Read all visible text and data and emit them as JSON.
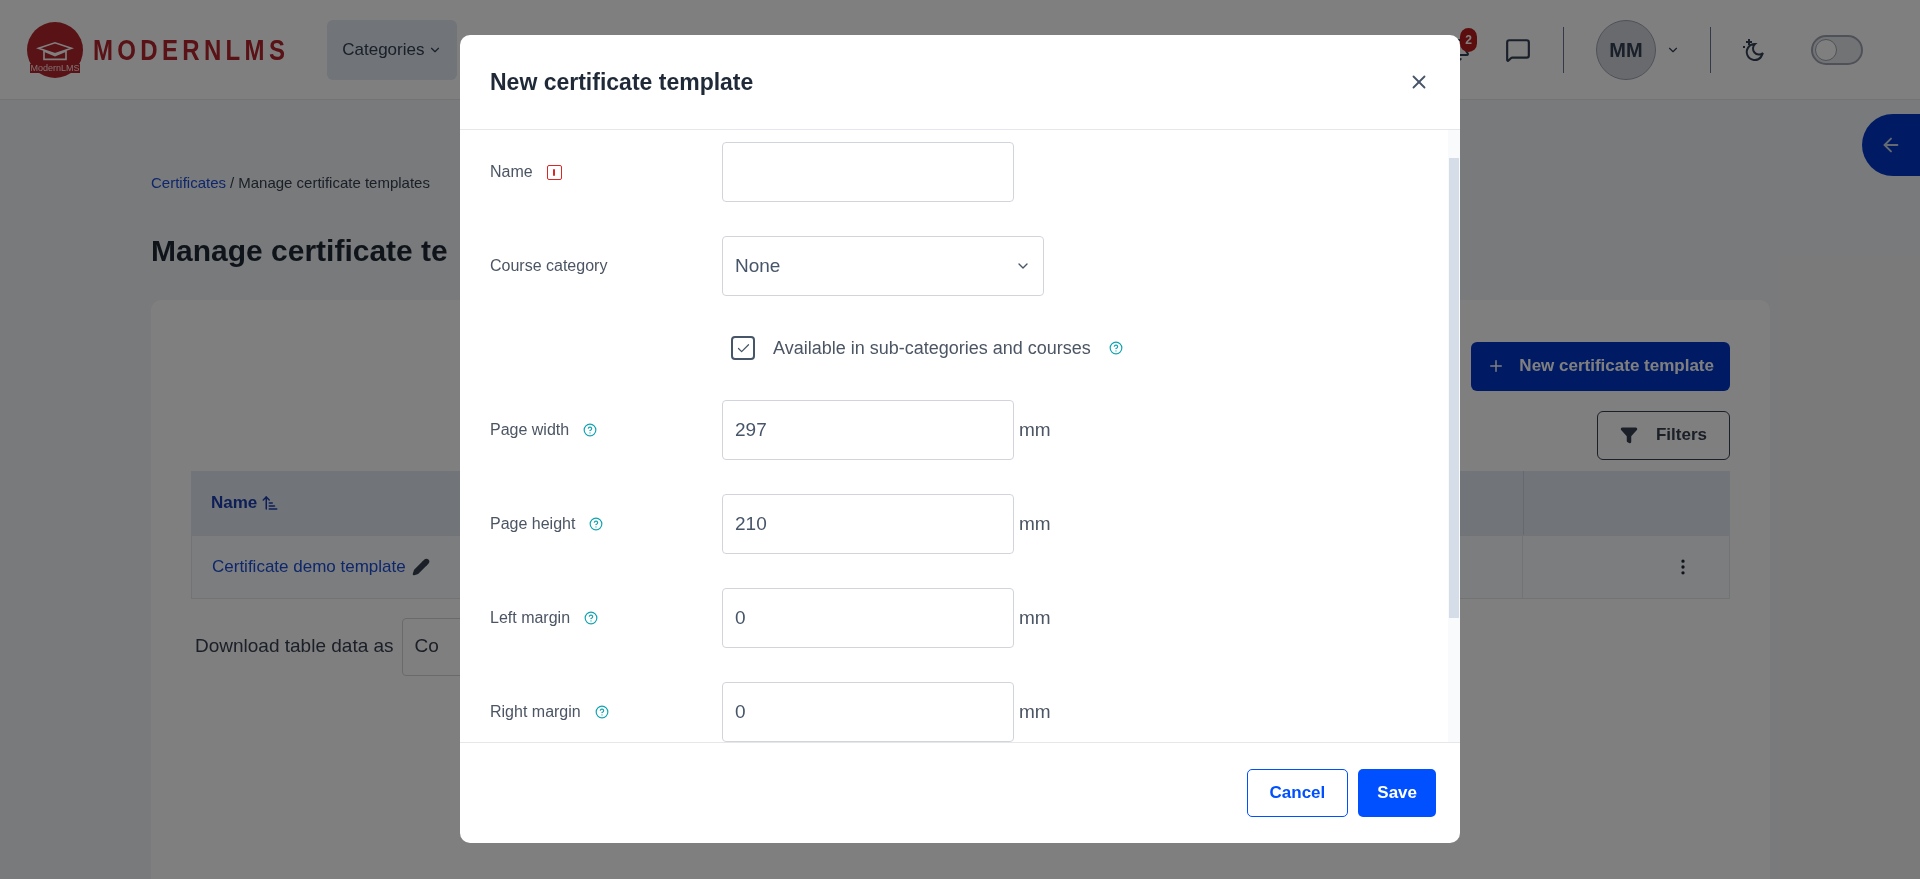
{
  "header": {
    "logo_text": "MODERNLMS",
    "logo_badge_text": "ModernLMS",
    "nav": [
      {
        "label": "Categories"
      }
    ],
    "notifications_count": "2",
    "avatar_initials": "MM",
    "dark_mode": {
      "on": false
    }
  },
  "breadcrumb": [
    {
      "label": "Certificates",
      "kind": "link"
    },
    {
      "label": "/",
      "kind": "separator"
    },
    {
      "label": "Manage certificate templates",
      "kind": "current"
    }
  ],
  "page_title": "Manage certificate te",
  "add_button": "New certificate template",
  "filters_button": "Filters",
  "table": {
    "columns": [
      {
        "label": "Name"
      }
    ],
    "rows": [
      {
        "name": "Certificate demo template"
      }
    ]
  },
  "download": {
    "label": "Download table data as",
    "value": "Co"
  },
  "modal": {
    "title": "New certificate template",
    "fields": [
      {
        "kind": "text",
        "label": "Name",
        "required": true,
        "help": false
      },
      {
        "kind": "select",
        "label": "Course category",
        "value": "None",
        "required": false,
        "help": false
      },
      {
        "kind": "checkbox",
        "label": "Available in sub-categories and courses",
        "checked": true,
        "help": true
      },
      {
        "kind": "number",
        "label": "Page width",
        "value": "297",
        "unit": "mm",
        "required": false,
        "help": true
      },
      {
        "kind": "number",
        "label": "Page height",
        "value": "210",
        "unit": "mm",
        "required": false,
        "help": true
      },
      {
        "kind": "number",
        "label": "Left margin",
        "value": "0",
        "unit": "mm",
        "required": false,
        "help": true
      },
      {
        "kind": "number",
        "label": "Right margin",
        "value": "0",
        "unit": "mm",
        "required": false,
        "help": true
      }
    ],
    "buttons": [
      {
        "label": "Cancel",
        "kind": "secondary"
      },
      {
        "label": "Save",
        "kind": "primary"
      }
    ]
  }
}
